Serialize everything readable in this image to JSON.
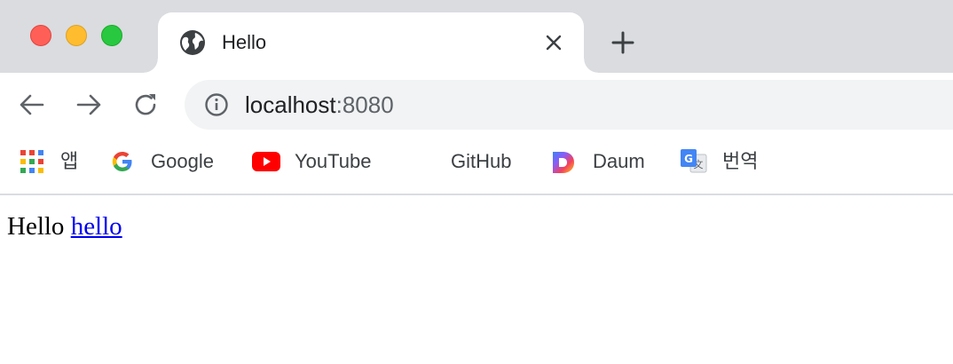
{
  "window": {
    "traffic_lights": {
      "close_color": "#ff5f57",
      "minimize_color": "#febc2e",
      "zoom_color": "#28c840"
    }
  },
  "tab": {
    "title": "Hello",
    "icon": "globe-icon",
    "close_icon": "close-icon"
  },
  "new_tab_icon": "plus-icon",
  "toolbar": {
    "back_icon": "arrow-left-icon",
    "forward_icon": "arrow-right-icon",
    "reload_icon": "reload-icon",
    "omnibox": {
      "info_icon": "info-icon",
      "host": "localhost",
      "port": ":8080"
    }
  },
  "bookmarks": [
    {
      "label": "앱",
      "icon": "apps-grid-icon"
    },
    {
      "label": "Google",
      "icon": "google-icon"
    },
    {
      "label": "YouTube",
      "icon": "youtube-icon"
    },
    {
      "label": "GitHub",
      "icon": "github-icon"
    },
    {
      "label": "Daum",
      "icon": "daum-icon"
    },
    {
      "label": "번역",
      "icon": "google-translate-icon"
    }
  ],
  "page": {
    "text": "Hello",
    "link_text": "hello",
    "link_color": "#0000ee"
  }
}
